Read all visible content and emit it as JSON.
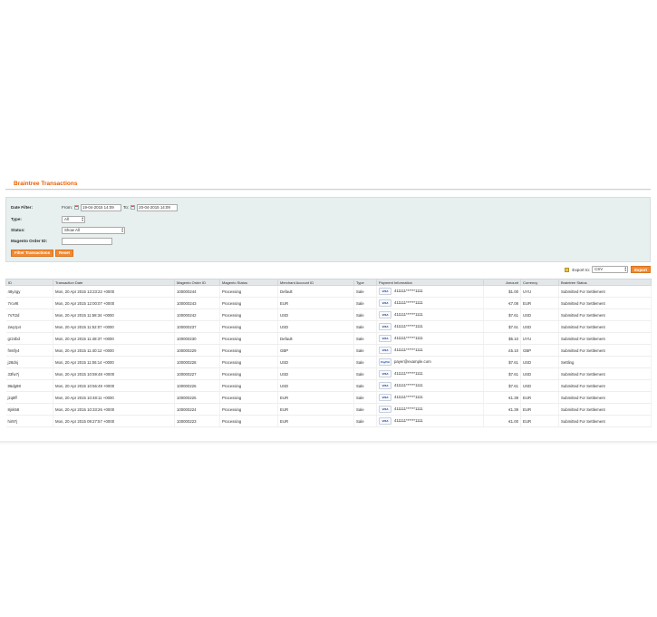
{
  "page": {
    "title": "Braintree Transactions"
  },
  "filters": {
    "date_filter_label": "Date Filter:",
    "from_label": "From:",
    "from_value": "19-04-2015 14:09",
    "to_label": "To:",
    "to_value": "20-04-2015 14:09",
    "type_label": "Type:",
    "type_value": "All",
    "status_label": "Status:",
    "status_value": "Show All",
    "order_id_label": "Magento Order ID:",
    "order_id_value": "",
    "filter_button": "Filter Transactions",
    "reset_button": "Reset"
  },
  "export": {
    "label": "Export to:",
    "format": "CSV",
    "button": "Export"
  },
  "grid": {
    "headers": [
      "ID",
      "Transaction Date",
      "Magento Order ID",
      "Magento Status",
      "Merchant Account ID",
      "Type",
      "Payment Information",
      "Amount",
      "Currency",
      "Braintree Status"
    ],
    "rows": [
      {
        "id": "48y4gy",
        "date": "Mon, 20 Apr 2015 13:23:22 +0000",
        "order": "100000244",
        "mstatus": "Processing",
        "merchant": "Default",
        "type": "Sale",
        "card": "VISA",
        "payment": "411111******1111",
        "amount": "$1.00",
        "currency": "UYU",
        "bstatus": "Submitted For Settlement"
      },
      {
        "id": "7rcv9t",
        "date": "Mon, 20 Apr 2015 12:00:07 +0000",
        "order": "100000243",
        "mstatus": "Processing",
        "merchant": "EUR",
        "type": "Sale",
        "card": "VISA",
        "payment": "411111******1111",
        "amount": "€7.08",
        "currency": "EUR",
        "bstatus": "Submitted For Settlement"
      },
      {
        "id": "7s7t2d",
        "date": "Mon, 20 Apr 2015 11:58:34 +0000",
        "order": "100000242",
        "mstatus": "Processing",
        "merchant": "USD",
        "type": "Sale",
        "card": "VISA",
        "payment": "411111******1111",
        "amount": "$7.61",
        "currency": "USD",
        "bstatus": "Submitted For Settlement"
      },
      {
        "id": "2wyzp4",
        "date": "Mon, 20 Apr 2015 11:52:07 +0000",
        "order": "100000237",
        "mstatus": "Processing",
        "merchant": "USD",
        "type": "Sale",
        "card": "VISA",
        "payment": "411111******1111",
        "amount": "$7.61",
        "currency": "USD",
        "bstatus": "Submitted For Settlement"
      },
      {
        "id": "gr24bd",
        "date": "Mon, 20 Apr 2015 11:48:37 +0000",
        "order": "100000230",
        "mstatus": "Processing",
        "merchant": "Default",
        "type": "Sale",
        "card": "VISA",
        "payment": "411111******1111",
        "amount": "$5.10",
        "currency": "UYU",
        "bstatus": "Submitted For Settlement"
      },
      {
        "id": "fm6fy4",
        "date": "Mon, 20 Apr 2015 11:40:12 +0000",
        "order": "100000229",
        "mstatus": "Processing",
        "merchant": "GBP",
        "type": "Sale",
        "card": "VISA",
        "payment": "411111******1111",
        "amount": "£5.10",
        "currency": "GBP",
        "bstatus": "Submitted For Settlement"
      },
      {
        "id": "j28dnj",
        "date": "Mon, 20 Apr 2015 11:06:14 +0000",
        "order": "100000228",
        "mstatus": "Processing",
        "merchant": "USD",
        "type": "Sale",
        "card": "PayPal",
        "payment": "payer@example.com",
        "amount": "$7.61",
        "currency": "USD",
        "bstatus": "Settling"
      },
      {
        "id": "33fw7j",
        "date": "Mon, 20 Apr 2015 10:59:48 +0000",
        "order": "100000227",
        "mstatus": "Processing",
        "merchant": "USD",
        "type": "Sale",
        "card": "VISA",
        "payment": "411111******1111",
        "amount": "$7.61",
        "currency": "USD",
        "bstatus": "Submitted For Settlement"
      },
      {
        "id": "86dg98",
        "date": "Mon, 20 Apr 2015 10:56:49 +0000",
        "order": "100000226",
        "mstatus": "Processing",
        "merchant": "USD",
        "type": "Sale",
        "card": "VISA",
        "payment": "411111******1111",
        "amount": "$7.61",
        "currency": "USD",
        "bstatus": "Submitted For Settlement"
      },
      {
        "id": "jzq8ff",
        "date": "Mon, 20 Apr 2015 10:48:11 +0000",
        "order": "100000225",
        "mstatus": "Processing",
        "merchant": "EUR",
        "type": "Sale",
        "card": "VISA",
        "payment": "411111******1111",
        "amount": "€1.39",
        "currency": "EUR",
        "bstatus": "Submitted For Settlement"
      },
      {
        "id": "8jnk58",
        "date": "Mon, 20 Apr 2015 10:33:26 +0000",
        "order": "100000224",
        "mstatus": "Processing",
        "merchant": "EUR",
        "type": "Sale",
        "card": "VISA",
        "payment": "411111******1111",
        "amount": "€1.39",
        "currency": "EUR",
        "bstatus": "Submitted For Settlement"
      },
      {
        "id": "hir97j",
        "date": "Mon, 20 Apr 2015 09:27:57 +0000",
        "order": "100000223",
        "mstatus": "Processing",
        "merchant": "EUR",
        "type": "Sale",
        "card": "VISA",
        "payment": "411111******1111",
        "amount": "€1.00",
        "currency": "EUR",
        "bstatus": "Submitted For Settlement"
      }
    ]
  },
  "colors": {
    "accent": "#eb5e00",
    "button": "#f18a32",
    "panel": "#e7efef"
  }
}
